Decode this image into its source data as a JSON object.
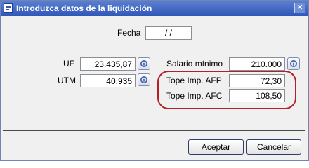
{
  "window": {
    "title": "Introduzca datos de la liquidación",
    "close_glyph": "✕"
  },
  "fields": {
    "fecha": {
      "label": "Fecha",
      "value": "/ /"
    },
    "uf": {
      "label": "UF",
      "value": "23.435,87"
    },
    "utm": {
      "label": "UTM",
      "value": "40.935"
    },
    "salario_minimo": {
      "label": "Salario mínimo",
      "value": "210.000"
    },
    "tope_afp": {
      "label": "Tope Imp. AFP",
      "value": "72,30"
    },
    "tope_afc": {
      "label": "Tope Imp. AFC",
      "value": "108,50"
    }
  },
  "buttons": {
    "accept": "Aceptar",
    "cancel": "Cancelar"
  },
  "colors": {
    "title_bar": "#2f57b8",
    "highlight": "#b3202a",
    "background": "#f0f0f0"
  },
  "icons": {
    "lookup": "info-lookup-icon",
    "window": "window-icon",
    "close": "close-icon"
  }
}
